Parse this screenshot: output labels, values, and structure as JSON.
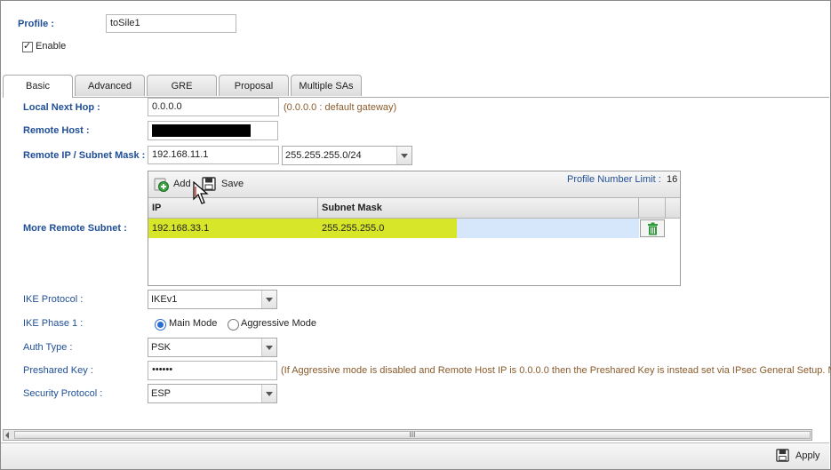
{
  "profile": {
    "label": "Profile :",
    "value": "toSile1"
  },
  "enable": {
    "label": "Enable",
    "checked": true
  },
  "tabs": [
    {
      "label": "Basic",
      "active": true
    },
    {
      "label": "Advanced"
    },
    {
      "label": "GRE"
    },
    {
      "label": "Proposal"
    },
    {
      "label": "Multiple SAs"
    }
  ],
  "fields": {
    "local_next_hop": {
      "label": "Local Next Hop :",
      "value": "0.0.0.0",
      "hint": "(0.0.0.0 : default gateway)"
    },
    "remote_host": {
      "label": "Remote Host :"
    },
    "remote_ip": {
      "label": "Remote IP / Subnet Mask :",
      "ip": "192.168.11.1",
      "mask": "255.255.255.0/24"
    },
    "more_remote_subnet": {
      "label": "More Remote Subnet :"
    },
    "ike_protocol": {
      "label": "IKE Protocol :",
      "value": "IKEv1"
    },
    "ike_phase1": {
      "label": "IKE Phase 1 :",
      "options": [
        "Main Mode",
        "Aggressive Mode"
      ],
      "selected": "Main Mode"
    },
    "auth_type": {
      "label": "Auth Type :",
      "value": "PSK"
    },
    "preshared_key": {
      "label": "Preshared Key :",
      "value": "••••••",
      "hint": "(If Aggressive mode is disabled and Remote Host IP is 0.0.0.0 then the Preshared Key is instead set via IPsec General Setup. N"
    },
    "security_protocol": {
      "label": "Security Protocol :",
      "value": "ESP"
    }
  },
  "subnet_grid": {
    "add_label": "Add",
    "save_label": "Save",
    "limit_label": "Profile Number Limit :",
    "limit_value": "16",
    "columns": [
      "IP",
      "Subnet Mask"
    ],
    "rows": [
      {
        "ip": "192.168.33.1",
        "mask": "255.255.255.0"
      }
    ]
  },
  "scrollbar": {
    "thumb_glyph": "III"
  },
  "footer": {
    "apply_label": "Apply"
  },
  "colors": {
    "label_blue": "#1f4e96",
    "row_highlight": "#d7e628",
    "row_selected": "#d6e6fb",
    "delete_green": "#2e9a3a"
  },
  "icons": [
    "add-icon",
    "save-icon",
    "delete-icon",
    "apply-save-icon",
    "cursor-icon",
    "checkbox-icon"
  ]
}
